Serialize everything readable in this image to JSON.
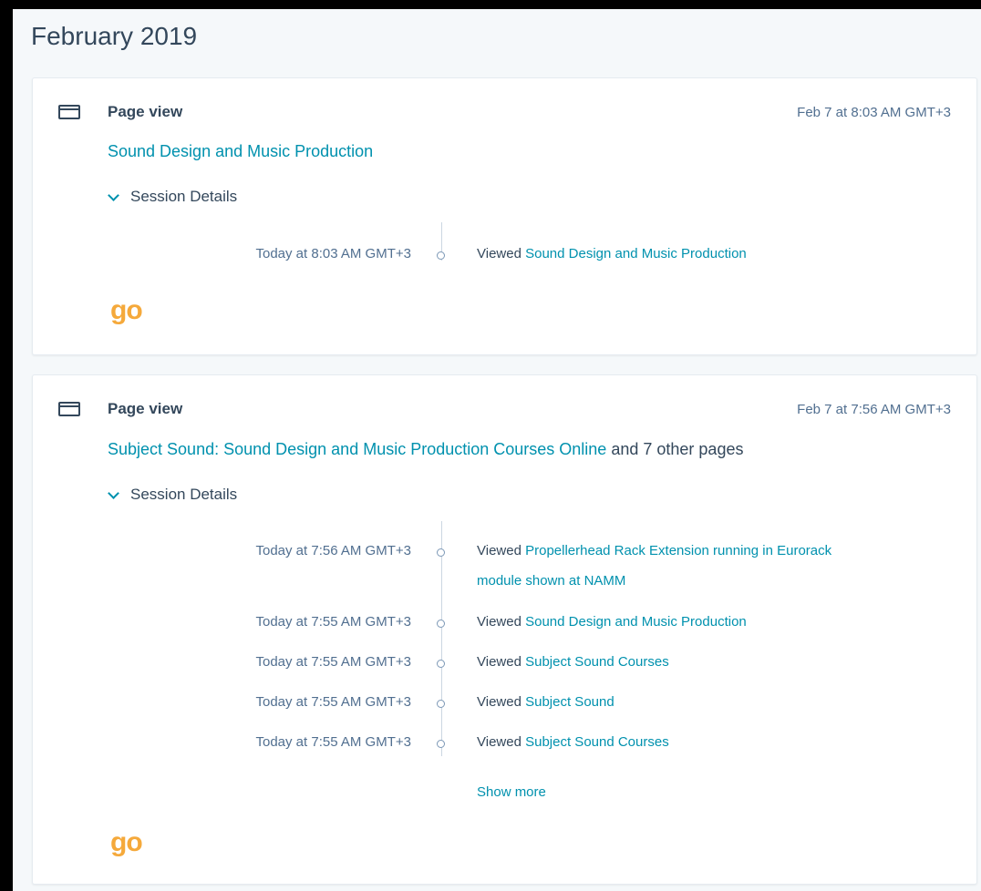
{
  "month_heading": "February 2019",
  "cards": [
    {
      "type_label": "Page view",
      "timestamp": "Feb 7 at 8:03 AM GMT+3",
      "title_link": "Sound Design and Music Production",
      "title_suffix": "",
      "session_toggle": "Session Details",
      "timeline": [
        {
          "time": "Today at 8:03 AM GMT+3",
          "prefix": "Viewed",
          "link": "Sound Design and Music Production"
        }
      ],
      "show_more": "",
      "logo_text": "go"
    },
    {
      "type_label": "Page view",
      "timestamp": "Feb 7 at 7:56 AM GMT+3",
      "title_link": "Subject Sound: Sound Design and Music Production Courses Online",
      "title_suffix": "and 7 other pages",
      "session_toggle": "Session Details",
      "timeline": [
        {
          "time": "Today at 7:56 AM GMT+3",
          "prefix": "Viewed",
          "link": "Propellerhead Rack Extension running in Eurorack module shown at NAMM"
        },
        {
          "time": "Today at 7:55 AM GMT+3",
          "prefix": "Viewed",
          "link": "Sound Design and Music Production"
        },
        {
          "time": "Today at 7:55 AM GMT+3",
          "prefix": "Viewed",
          "link": "Subject Sound Courses"
        },
        {
          "time": "Today at 7:55 AM GMT+3",
          "prefix": "Viewed",
          "link": "Subject Sound"
        },
        {
          "time": "Today at 7:55 AM GMT+3",
          "prefix": "Viewed",
          "link": "Subject Sound Courses"
        }
      ],
      "show_more": "Show more",
      "logo_text": "go"
    }
  ]
}
